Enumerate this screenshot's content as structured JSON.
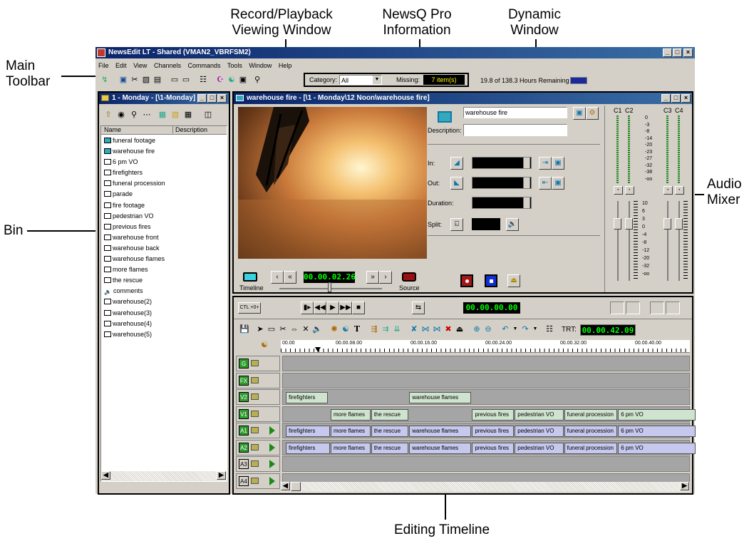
{
  "callouts": {
    "record_playback": "Record/Playback\nViewing Window",
    "newsq": "NewsQ Pro\nInformation",
    "dynamic": "Dynamic\nWindow",
    "main_toolbar": "Main\nToolbar",
    "bin": "Bin",
    "audio_mixer": "Audio\nMixer",
    "editing_timeline": "Editing Timeline"
  },
  "app": {
    "title": "NewsEdit LT - Shared (VMAN2_VBRFSM2)",
    "menus": [
      "File",
      "Edit",
      "View",
      "Channels",
      "Commands",
      "Tools",
      "Window",
      "Help"
    ]
  },
  "newsq": {
    "category_label": "Category:",
    "category_value": "All",
    "missing_label": "Missing:",
    "missing_value": "7 item(s)",
    "hours_remaining": "19.8 of 138.3 Hours Remaining"
  },
  "bin": {
    "title": "1 - Monday - [\\1-Monday]",
    "col_name": "Name",
    "col_description": "Description",
    "items": [
      "funeral footage",
      "warehouse fire",
      "6 pm VO",
      "firefighters",
      "funeral procession",
      "parade",
      "fire footage",
      "pedestrian VO",
      "previous fires",
      "warehouse front",
      "warehouse back",
      "warehouse flames",
      "more flames",
      "the rescue",
      "comments",
      "warehouse(2)",
      "warehouse(3)",
      "warehouse(4)",
      "warehouse(5)"
    ]
  },
  "viewer": {
    "title": "warehouse fire - [\\1 - Monday\\12 Noon\\warehouse fire]",
    "timecode": "00.00.02.26",
    "timeline_label": "Timeline",
    "source_label": "Source",
    "clip_name": "warehouse fire",
    "description_label": "Description:",
    "in_label": "In:",
    "out_label": "Out:",
    "duration_label": "Duration:",
    "split_label": "Split:"
  },
  "mixer": {
    "channels": [
      "C1",
      "C2",
      "C3",
      "C4"
    ],
    "scale": [
      "0",
      "-3",
      "-8",
      "-14",
      "-20",
      "-23",
      "-27",
      "-32",
      "-38",
      "-oo"
    ],
    "fader_scale": [
      "10",
      "6",
      "3",
      "0",
      "-4",
      "-8",
      "-12",
      "-20",
      "-32",
      "-oo"
    ]
  },
  "transport": {
    "ctl_label": "CTL",
    "plus_label": "+0+",
    "timecode": "00.00.00.00"
  },
  "timeline": {
    "trt_label": "TRT:",
    "trt_value": "00.00.42.09",
    "ruler": [
      "00.00",
      "00.00.08.00",
      "00.00.16.00",
      "00.00.24.00",
      "00.00.32.00",
      "00.00.40.00"
    ],
    "tracks": [
      {
        "name": "G",
        "active": true,
        "play": false,
        "clips": []
      },
      {
        "name": "FX",
        "active": true,
        "play": false,
        "clips": []
      },
      {
        "name": "V2",
        "active": true,
        "play": false,
        "clips": [
          {
            "label": "firefighters",
            "start": 0.0,
            "end": 1.9
          },
          {
            "label": "warehouse flames",
            "start": 5.5,
            "end": 8.3
          }
        ]
      },
      {
        "name": "V1",
        "active": true,
        "play": false,
        "clips": [
          {
            "label": "more flames",
            "start": 2.0,
            "end": 3.8
          },
          {
            "label": "the rescue",
            "start": 3.8,
            "end": 5.5
          },
          {
            "label": "previous fires",
            "start": 8.3,
            "end": 10.2
          },
          {
            "label": "pedestrian VO",
            "start": 10.2,
            "end": 12.4
          },
          {
            "label": "funeral procession",
            "start": 12.4,
            "end": 14.8
          },
          {
            "label": "6 pm VO",
            "start": 14.8,
            "end": 18.3
          }
        ]
      },
      {
        "name": "A1",
        "active": true,
        "play": true,
        "clips": [
          {
            "label": "firefighters",
            "start": 0.0,
            "end": 2.0
          },
          {
            "label": "more flames",
            "start": 2.0,
            "end": 3.8
          },
          {
            "label": "the rescue",
            "start": 3.8,
            "end": 5.5
          },
          {
            "label": "warehouse flames",
            "start": 5.5,
            "end": 8.3
          },
          {
            "label": "previous fires",
            "start": 8.3,
            "end": 10.2
          },
          {
            "label": "pedestrian VO",
            "start": 10.2,
            "end": 12.4
          },
          {
            "label": "funeral procession",
            "start": 12.4,
            "end": 14.8
          },
          {
            "label": "6 pm VO",
            "start": 14.8,
            "end": 18.3
          }
        ]
      },
      {
        "name": "A2",
        "active": true,
        "play": true,
        "clips": [
          {
            "label": "firefighters",
            "start": 0.0,
            "end": 2.0
          },
          {
            "label": "more flames",
            "start": 2.0,
            "end": 3.8
          },
          {
            "label": "the rescue",
            "start": 3.8,
            "end": 5.5
          },
          {
            "label": "warehouse flames",
            "start": 5.5,
            "end": 8.3
          },
          {
            "label": "previous fires",
            "start": 8.3,
            "end": 10.2
          },
          {
            "label": "pedestrian VO",
            "start": 10.2,
            "end": 12.4
          },
          {
            "label": "funeral procession",
            "start": 12.4,
            "end": 14.8
          },
          {
            "label": "6 pm VO",
            "start": 14.8,
            "end": 18.3
          }
        ]
      },
      {
        "name": "A3",
        "active": false,
        "play": true,
        "clips": []
      },
      {
        "name": "A4",
        "active": false,
        "play": true,
        "clips": []
      }
    ]
  }
}
